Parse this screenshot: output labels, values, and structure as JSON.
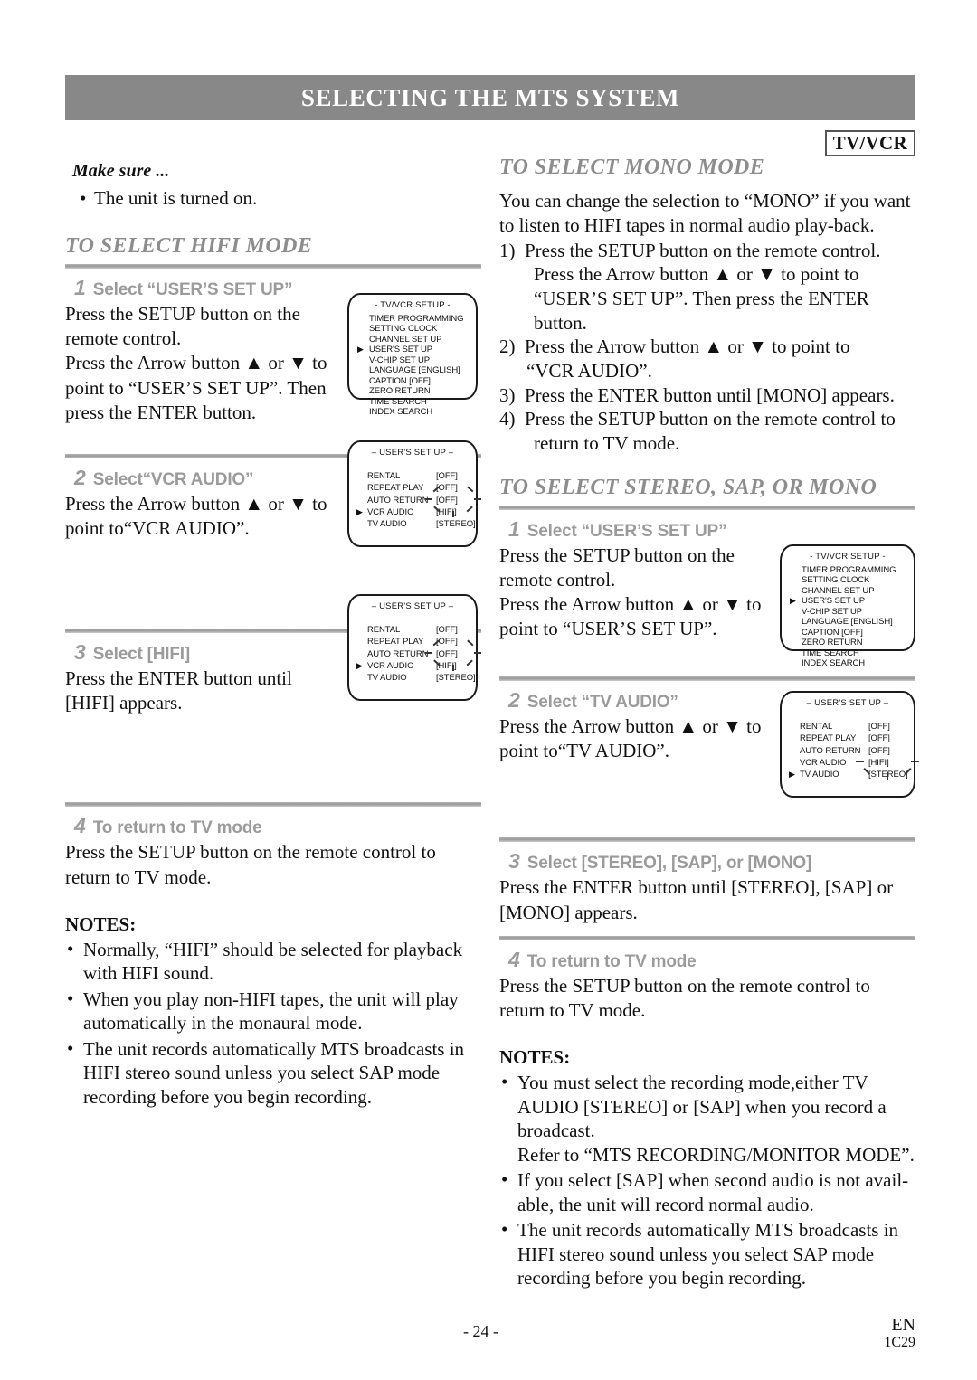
{
  "header": {
    "title": "SELECTING THE MTS SYSTEM",
    "badge": "TV/VCR"
  },
  "left_column": {
    "make_sure_heading": "Make sure ...",
    "make_sure_item": "The unit is turned on.",
    "section_title": "TO SELECT HIFI MODE",
    "steps": [
      {
        "num": "1",
        "label": "Select “USER’S SET UP”",
        "body_line1": "Press the SETUP button on the remote control.",
        "body_line2": "Press the Arrow button ▲ or ▼ to point to “USER’S SET UP”. Then press the ENTER button."
      },
      {
        "num": "2",
        "label": "Select“VCR AUDIO”",
        "body_line1": "Press the Arrow button ▲ or ▼ to point to“VCR AUDIO”."
      },
      {
        "num": "3",
        "label": "Select [HIFI]",
        "body_line1": "Press the ENTER button until [HIFI] appears."
      },
      {
        "num": "4",
        "label": "To return to TV mode",
        "body_line1": "Press the SETUP button on the remote control to return to TV mode."
      }
    ],
    "notes_heading": "NOTES:",
    "notes": [
      "Normally, “HIFI” should be selected for playback with HIFI sound.",
      "When you play non-HIFI tapes, the unit will play automatically in the monaural mode.",
      "The unit records automatically MTS broadcasts in HIFI stereo sound unless you select SAP mode recording before you begin recording."
    ]
  },
  "right_column": {
    "mono_section": {
      "title": "TO SELECT MONO MODE",
      "intro": "You can change the selection to “MONO” if you want to listen to HIFI tapes in normal audio play-back.",
      "items": [
        {
          "num": "1)",
          "text": "Press the SETUP button on the remote control.",
          "cont": "Press the Arrow button ▲ or ▼ to point to “USER’S SET UP”. Then press the ENTER button."
        },
        {
          "num": "2)",
          "text": "Press the Arrow button ▲ or ▼ to point to",
          "cont": "“VCR AUDIO”."
        },
        {
          "num": "3)",
          "text": "Press the ENTER button until [MONO] appears.",
          "cont": ""
        },
        {
          "num": "4)",
          "text": "Press the SETUP button on the remote control to",
          "cont": "return to TV mode."
        }
      ]
    },
    "stereo_section": {
      "title": "TO SELECT STEREO, SAP, OR MONO",
      "steps": [
        {
          "num": "1",
          "label": "Select “USER’S SET UP”",
          "body_line1": "Press the SETUP button on the remote control.",
          "body_line2": "Press the Arrow button ▲ or ▼ to point to “USER’S SET UP”."
        },
        {
          "num": "2",
          "label": "Select “TV AUDIO”",
          "body_line1": "Press the Arrow button ▲ or ▼ to point to“TV AUDIO”."
        },
        {
          "num": "3",
          "label": "Select [STEREO], [SAP], or [MONO]",
          "body_line1": "Press the ENTER button until [STEREO], [SAP] or [MONO] appears."
        },
        {
          "num": "4",
          "label": "To return to TV mode",
          "body_line1": "Press the SETUP button on the remote control to return to TV mode."
        }
      ],
      "notes_heading": "NOTES:",
      "notes": [
        {
          "text": "You must select the recording mode,either TV AUDIO [STEREO] or [SAP] when you record a broadcast.",
          "sub": "Refer to “MTS RECORDING/MONITOR MODE”."
        },
        {
          "text": "If you select [SAP] when second audio is not avail-able, the unit will record normal audio.",
          "sub": ""
        },
        {
          "text": "The unit records automatically MTS broadcasts in HIFI stereo sound unless you select SAP mode recording before you begin recording.",
          "sub": ""
        }
      ]
    }
  },
  "osd_setup_menu": {
    "title": "- TV/VCR SETUP -",
    "items": [
      {
        "label": "TIMER PROGRAMMING",
        "selected": false
      },
      {
        "label": "SETTING CLOCK",
        "selected": false
      },
      {
        "label": "CHANNEL SET UP",
        "selected": false
      },
      {
        "label": "USER'S SET UP",
        "selected": true
      },
      {
        "label": "V-CHIP SET UP",
        "selected": false
      },
      {
        "label": "LANGUAGE  [ENGLISH]",
        "selected": false
      },
      {
        "label": "CAPTION  [OFF]",
        "selected": false
      },
      {
        "label": "ZERO RETURN",
        "selected": false
      },
      {
        "label": "TIME SEARCH",
        "selected": false
      },
      {
        "label": "INDEX SEARCH",
        "selected": false
      }
    ]
  },
  "osd_users_setup_vcr": {
    "title": "– USER'S SET UP –",
    "rows": [
      {
        "key": "RENTAL",
        "value": "[OFF]",
        "selected": false,
        "blink": false
      },
      {
        "key": "REPEAT PLAY",
        "value": "[OFF]",
        "selected": false,
        "blink": false
      },
      {
        "key": "AUTO RETURN",
        "value": "[OFF]",
        "selected": false,
        "blink": false
      },
      {
        "key": "VCR AUDIO",
        "value": "[HIFI]",
        "selected": true,
        "blink": true
      },
      {
        "key": "TV AUDIO",
        "value": "[STEREO]",
        "selected": false,
        "blink": false
      }
    ]
  },
  "osd_users_setup_tv": {
    "title": "– USER'S SET UP –",
    "rows": [
      {
        "key": "RENTAL",
        "value": "[OFF]",
        "selected": false,
        "blink": false
      },
      {
        "key": "REPEAT PLAY",
        "value": "[OFF]",
        "selected": false,
        "blink": false
      },
      {
        "key": "AUTO RETURN",
        "value": "[OFF]",
        "selected": false,
        "blink": false
      },
      {
        "key": "VCR AUDIO",
        "value": "[HIFI]",
        "selected": false,
        "blink": false
      },
      {
        "key": "TV AUDIO",
        "value": "[STEREO]",
        "selected": true,
        "blink": true
      }
    ]
  },
  "footer": {
    "page_number": "- 24 -",
    "language_code": "EN",
    "doc_code": "1C29"
  },
  "colors": {
    "header_bar": "#888888",
    "section_title": "#8d8d8d",
    "step_label": "#9b9b9b",
    "rule": "#a6a6a6",
    "text": "#111111"
  }
}
